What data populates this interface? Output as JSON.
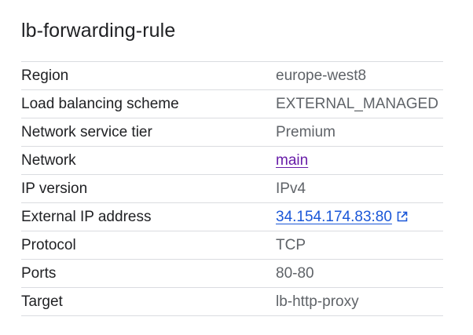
{
  "header": {
    "title": "lb-forwarding-rule"
  },
  "details": {
    "rows": [
      {
        "key": "Region",
        "value": "europe-west8"
      },
      {
        "key": "Load balancing scheme",
        "value": "EXTERNAL_MANAGED"
      },
      {
        "key": "Network service tier",
        "value": "Premium"
      },
      {
        "key": "Network",
        "value": "main"
      },
      {
        "key": "IP version",
        "value": "IPv4"
      },
      {
        "key": "External IP address",
        "value": "34.154.174.83:80"
      },
      {
        "key": "Protocol",
        "value": "TCP"
      },
      {
        "key": "Ports",
        "value": "80-80"
      },
      {
        "key": "Target",
        "value": "lb-http-proxy"
      }
    ]
  },
  "icons": {
    "external_link": "open-in-new-icon"
  },
  "colors": {
    "visited_link": "#681da8",
    "link": "#1a57d8",
    "divider": "#dadce0"
  }
}
